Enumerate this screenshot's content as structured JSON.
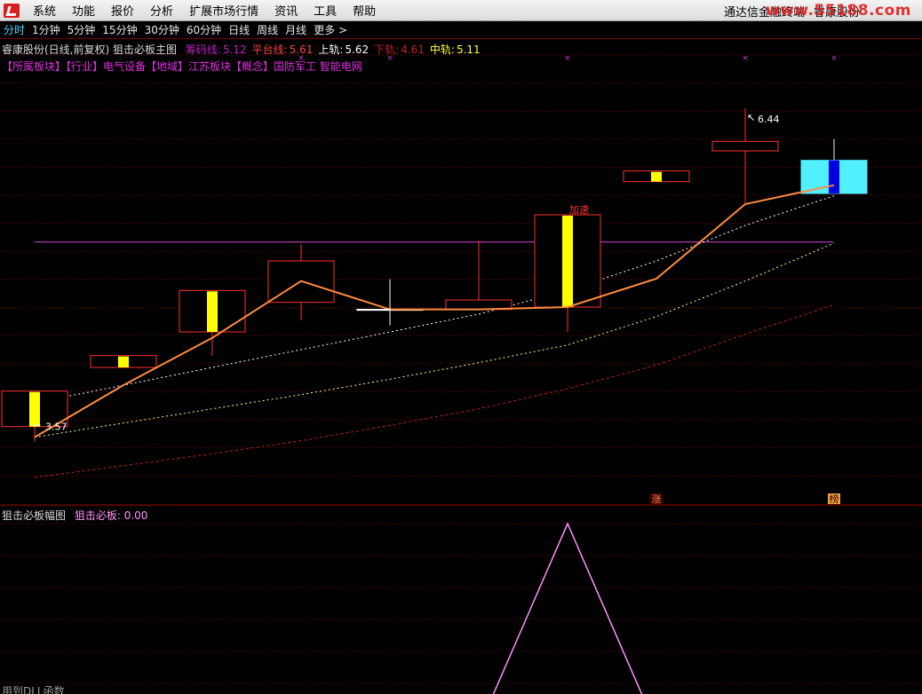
{
  "menu": {
    "items": [
      "系统",
      "功能",
      "报价",
      "分析",
      "扩展市场行情",
      "资讯",
      "工具",
      "帮助"
    ],
    "right_app": "通达信金融终端",
    "right_stock": "睿康股份",
    "watermark": "www.55188.com"
  },
  "periods": [
    "分时",
    "1分钟",
    "5分钟",
    "15分钟",
    "30分钟",
    "60分钟",
    "日线",
    "周线",
    "月线",
    "更多 >"
  ],
  "main_panel": {
    "title": "睿康股份(日线,前复权) 狙击必板主图",
    "indicators": [
      {
        "label": "筹码线:",
        "value": "5.12",
        "color": "#c020c0"
      },
      {
        "label": "平台线:",
        "value": "5.61",
        "color": "#ff4040"
      },
      {
        "label": "上轨:",
        "value": "5.62",
        "color": "#ffffff"
      },
      {
        "label": "下轨:",
        "value": "4.61",
        "color": "#c02020"
      },
      {
        "label": "中轨:",
        "value": "5.11",
        "color": "#ffff40"
      }
    ],
    "sector_line": "【所属板块】【行业】电气设备【地域】江苏板块【概念】国防军工 智能电网",
    "price_high_label": "6.44",
    "price_low_label": "3.57",
    "accel_label": "加速",
    "zhang_label": "涨",
    "bang_label": "榜"
  },
  "sub_panel": {
    "title": "狙击必板幅图",
    "indicator_label": "狙击必板:",
    "indicator_value": "0.00"
  },
  "footer_text": "用到DLL函数",
  "colors": {
    "up_candle": "#ff3030",
    "yellow_bar": "#ffff00",
    "cyan_candle": "#50f0ff",
    "blue_bar": "#0000e0",
    "orange_line": "#ff8c40",
    "magenta_line": "#c040c0",
    "sub_line": "#ff90ff",
    "grid": "#5a0000"
  },
  "chart_data": {
    "type": "candlestick",
    "y_range": [
      3.2,
      6.8
    ],
    "candles": [
      {
        "open": 3.75,
        "close": 4.05,
        "high": 4.05,
        "low": 3.62,
        "color": "red",
        "mark": "yellow"
      },
      {
        "open": 4.25,
        "close": 4.35,
        "high": 4.35,
        "low": 4.25,
        "color": "red",
        "mark": "yellow"
      },
      {
        "open": 4.55,
        "close": 4.9,
        "high": 4.9,
        "low": 4.35,
        "color": "red",
        "mark": "yellow"
      },
      {
        "open": 4.8,
        "close": 5.15,
        "high": 5.29,
        "low": 4.65,
        "color": "red",
        "mark": "none"
      },
      {
        "open": 4.74,
        "close": 4.74,
        "high": 4.89,
        "low": 4.69,
        "color": "white",
        "mark": "none"
      },
      {
        "open": 4.74,
        "close": 4.82,
        "high": 5.32,
        "low": 4.74,
        "color": "red",
        "mark": "none"
      },
      {
        "open": 4.76,
        "close": 5.54,
        "high": 5.54,
        "low": 4.55,
        "color": "red",
        "mark": "yellow"
      },
      {
        "open": 5.82,
        "close": 5.91,
        "high": 5.91,
        "low": 5.82,
        "color": "red",
        "mark": "yellow"
      },
      {
        "open": 6.08,
        "close": 6.16,
        "high": 6.44,
        "low": 5.63,
        "color": "red",
        "mark": "none"
      },
      {
        "open": 5.72,
        "close": 6.0,
        "high": 6.18,
        "low": 5.72,
        "color": "cyan",
        "mark": "blue"
      }
    ],
    "orange_line": [
      3.66,
      4.1,
      4.5,
      4.98,
      4.74,
      4.74,
      4.76,
      5.0,
      5.63,
      5.79
    ],
    "white_dotted": [
      3.95,
      4.1,
      4.25,
      4.4,
      4.55,
      4.7,
      4.9,
      5.15,
      5.45,
      5.7
    ],
    "yellow_dotted": [
      3.66,
      3.78,
      3.9,
      4.02,
      4.15,
      4.29,
      4.44,
      4.68,
      4.98,
      5.3
    ],
    "red_dotted": [
      3.32,
      3.42,
      3.52,
      3.63,
      3.76,
      3.9,
      4.07,
      4.27,
      4.53,
      4.78
    ],
    "magenta_level": 5.31,
    "sub_series": [
      0,
      0,
      0,
      0,
      0,
      0,
      1,
      0,
      0,
      0
    ]
  }
}
